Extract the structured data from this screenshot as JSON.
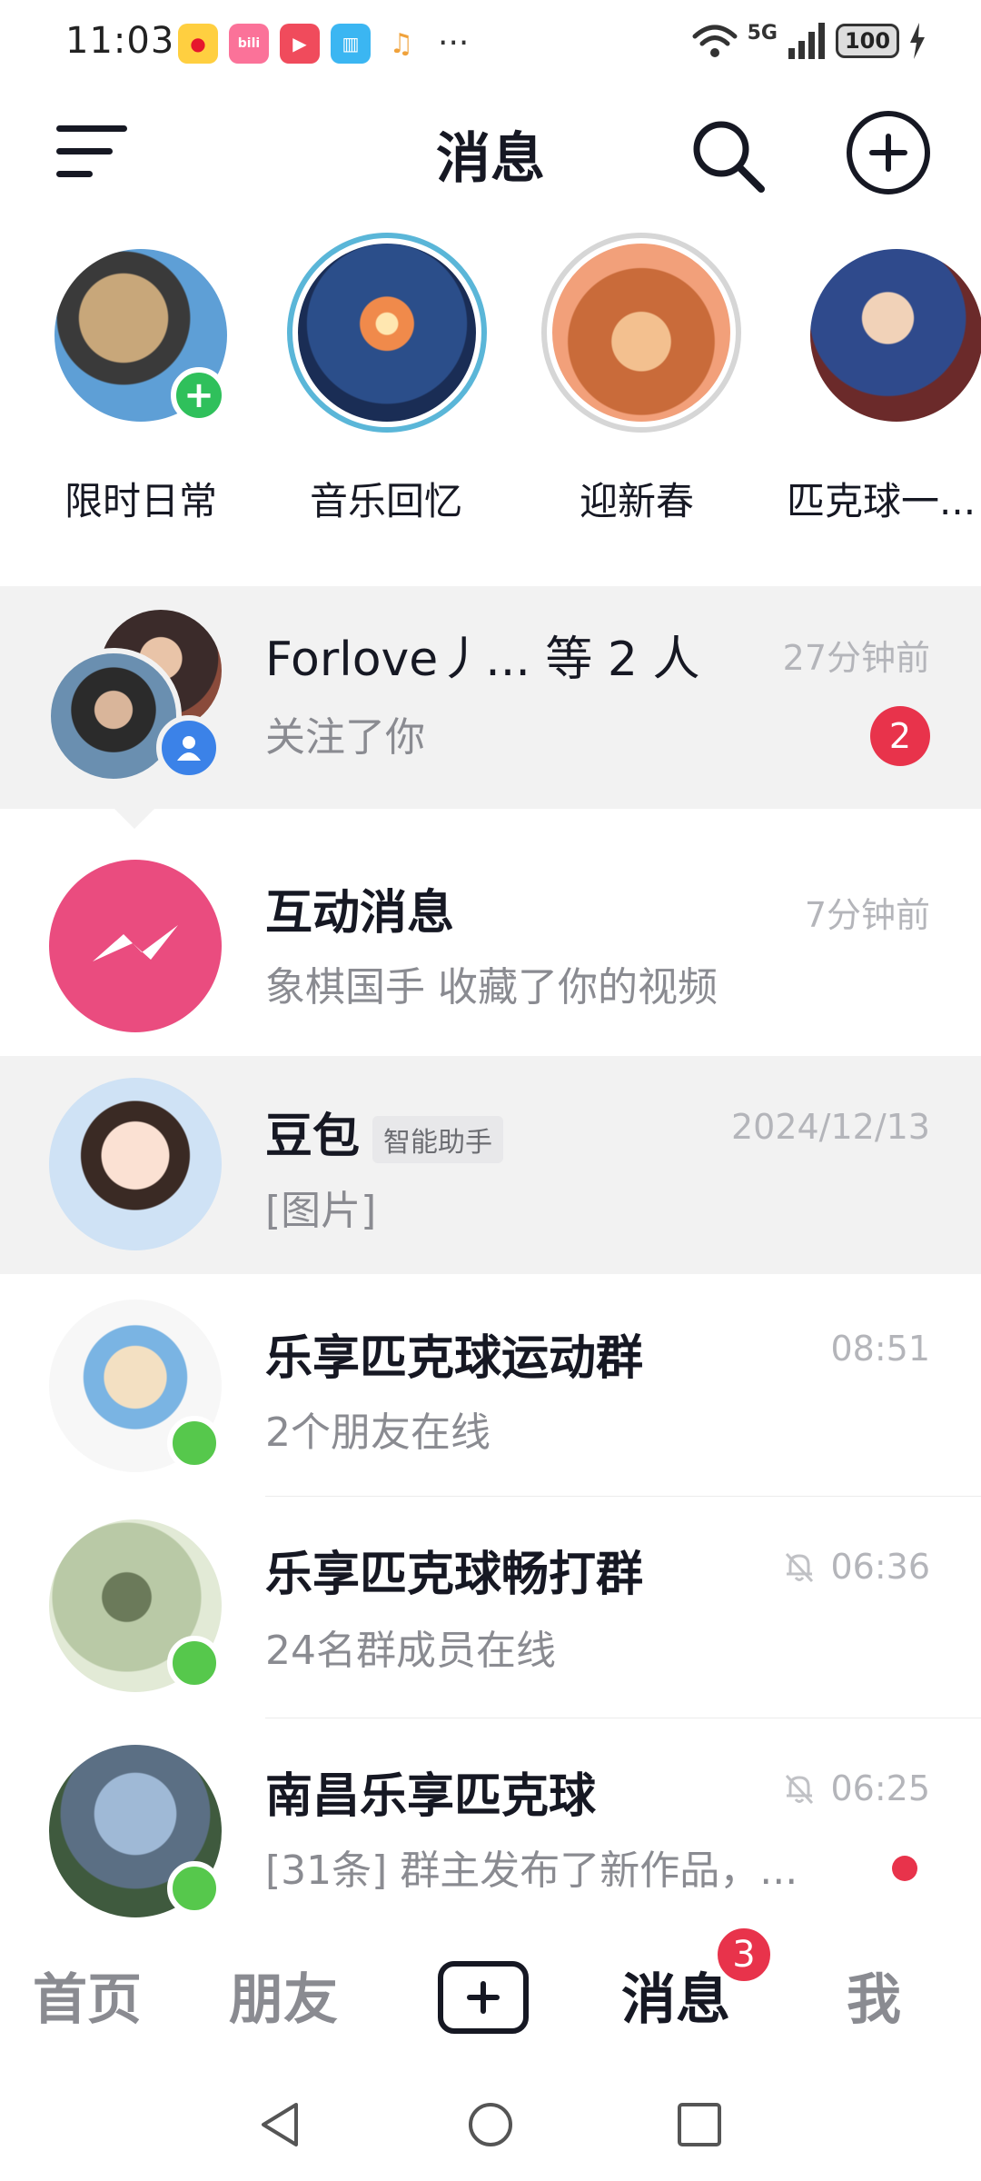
{
  "status_bar": {
    "time": "11:03",
    "more": "···",
    "battery": "100",
    "network": "5G"
  },
  "header": {
    "title": "消息"
  },
  "stories": [
    {
      "label": "限时日常"
    },
    {
      "label": "音乐回忆"
    },
    {
      "label": "迎新春"
    },
    {
      "label": "匹克球一..."
    }
  ],
  "conversations": [
    {
      "name": "Forlove丿... 等 2 人",
      "subtitle": "关注了你",
      "time": "27分钟前",
      "badge": "2"
    },
    {
      "name": "互动消息",
      "subtitle": "象棋国手 收藏了你的视频",
      "time": "7分钟前"
    },
    {
      "name": "豆包",
      "tag": "智能助手",
      "subtitle": "[图片]",
      "time": "2024/12/13"
    },
    {
      "name": "乐享匹克球运动群",
      "subtitle": "2个朋友在线",
      "time": "08:51"
    },
    {
      "name": "乐享匹克球畅打群",
      "subtitle": "24名群成员在线",
      "time": "06:36",
      "muted": true
    },
    {
      "name": "南昌乐享匹克球",
      "subtitle": "[31条] 群主发布了新作品，...",
      "time": "06:25",
      "muted": true
    }
  ],
  "bottom_nav": {
    "home": "首页",
    "friends": "朋友",
    "messages": "消息",
    "messages_badge": "3",
    "me": "我"
  },
  "colors": {
    "accent_red": "#e8334b",
    "online_green": "#56c84c",
    "interaction_pink": "#ea4c7f"
  }
}
